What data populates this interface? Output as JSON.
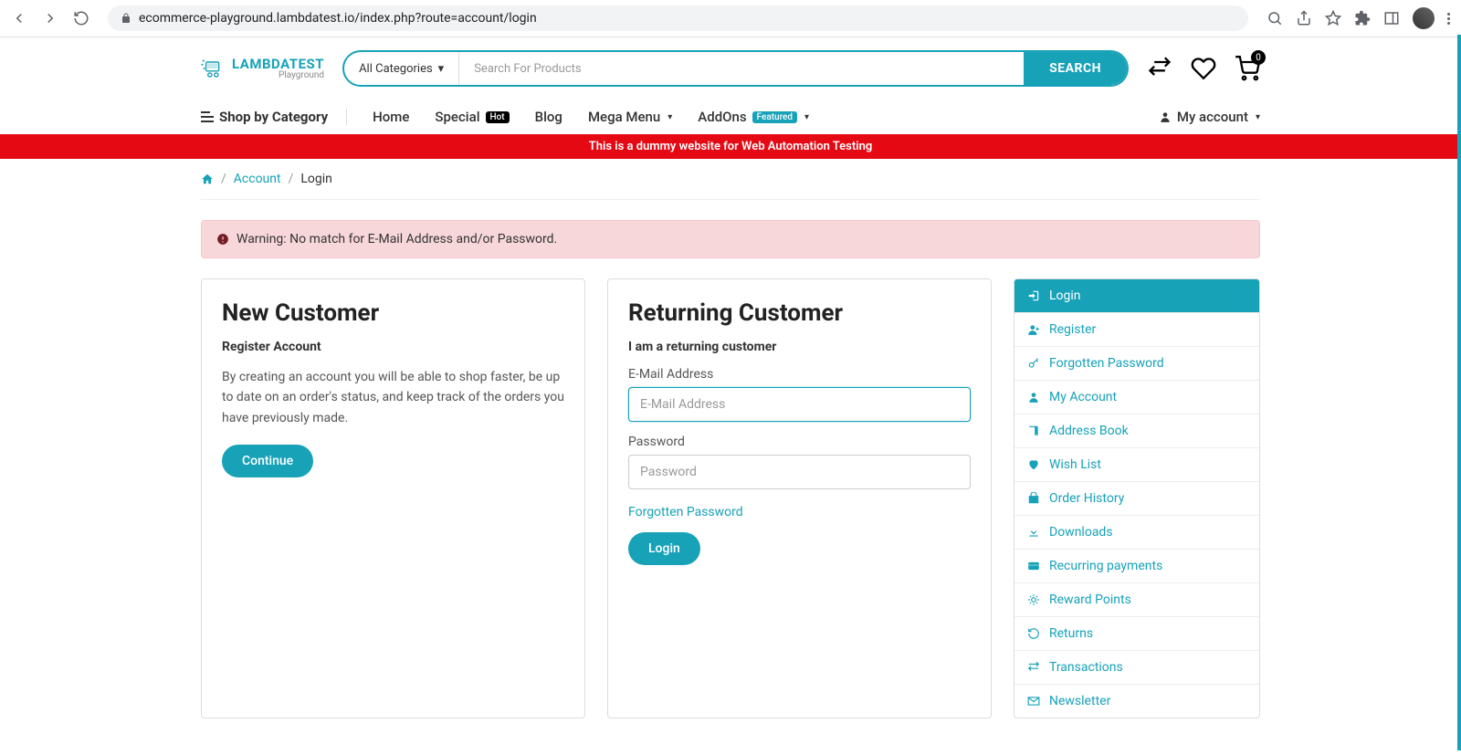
{
  "browser": {
    "url": "ecommerce-playground.lambdatest.io/index.php?route=account/login"
  },
  "logo": {
    "main": "LAMBDATEST",
    "sub": "Playground"
  },
  "search": {
    "category": "All Categories",
    "placeholder": "Search For Products",
    "button": "SEARCH"
  },
  "cart_count": "0",
  "nav": {
    "shop_by_category": "Shop by Category",
    "home": "Home",
    "special": "Special",
    "special_badge": "Hot",
    "blog": "Blog",
    "mega_menu": "Mega Menu",
    "addons": "AddOns",
    "addons_badge": "Featured",
    "my_account": "My account"
  },
  "banner": "This is a dummy website for Web Automation Testing",
  "breadcrumb": {
    "account": "Account",
    "current": "Login"
  },
  "alert": "Warning: No match for E-Mail Address and/or Password.",
  "new_customer": {
    "title": "New Customer",
    "subtitle": "Register Account",
    "text": "By creating an account you will be able to shop faster, be up to date on an order's status, and keep track of the orders you have previously made.",
    "button": "Continue"
  },
  "returning": {
    "title": "Returning Customer",
    "subtitle": "I am a returning customer",
    "email_label": "E-Mail Address",
    "email_placeholder": "E-Mail Address",
    "password_label": "Password",
    "password_placeholder": "Password",
    "forgot": "Forgotten Password",
    "button": "Login"
  },
  "sidebar": [
    {
      "label": "Login",
      "icon": "login",
      "active": true
    },
    {
      "label": "Register",
      "icon": "register"
    },
    {
      "label": "Forgotten Password",
      "icon": "key"
    },
    {
      "label": "My Account",
      "icon": "user"
    },
    {
      "label": "Address Book",
      "icon": "book"
    },
    {
      "label": "Wish List",
      "icon": "heart"
    },
    {
      "label": "Order History",
      "icon": "bag"
    },
    {
      "label": "Downloads",
      "icon": "download"
    },
    {
      "label": "Recurring payments",
      "icon": "card"
    },
    {
      "label": "Reward Points",
      "icon": "star"
    },
    {
      "label": "Returns",
      "icon": "undo"
    },
    {
      "label": "Transactions",
      "icon": "exchange"
    },
    {
      "label": "Newsletter",
      "icon": "mail"
    }
  ]
}
